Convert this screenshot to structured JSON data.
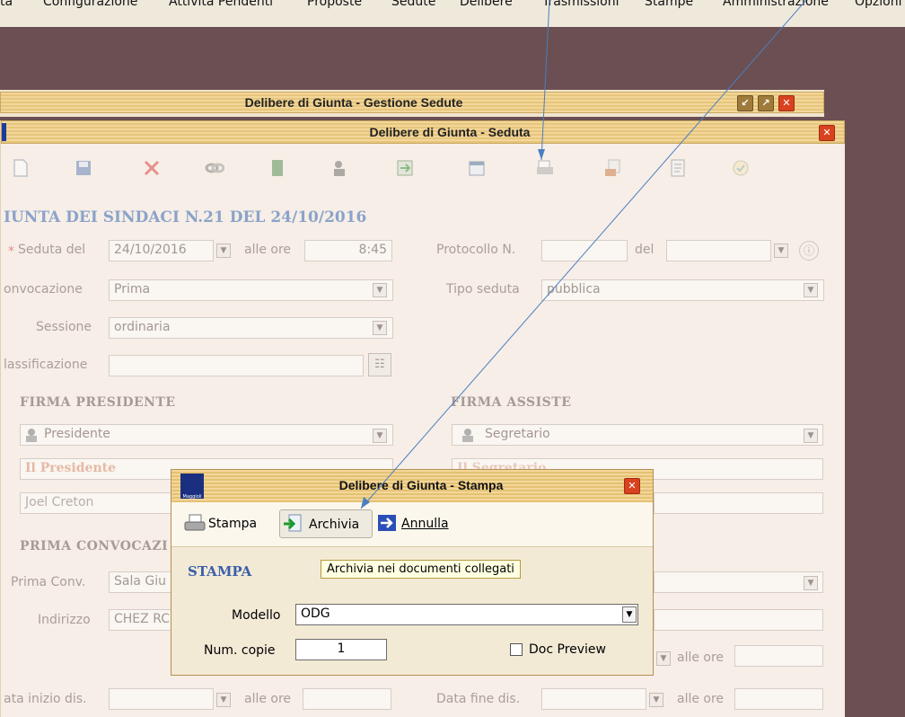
{
  "menu": [
    "ta",
    "Configurazione",
    "Attività Pendenti",
    "Proposte",
    "Sedute",
    "Delibere",
    "Trasmissioni",
    "Stampe",
    "Amministrazione",
    "Opzioni"
  ],
  "window_back": {
    "title": "Delibere di Giunta - Gestione Sedute"
  },
  "window_front": {
    "title": "Delibere di Giunta - Seduta"
  },
  "toolbar_icons": [
    "new-icon",
    "save-icon",
    "delete-icon",
    "link-icon",
    "book-icon",
    "users-icon",
    "import-icon",
    "calendar-icon",
    "print-icon",
    "archive-icon",
    "document-icon",
    "check-icon"
  ],
  "form": {
    "heading": "IUNTA DEI SINDACI N.21 DEL 24/10/2016",
    "seduta_del": {
      "label": "Seduta del",
      "required_mark": "*",
      "value": "24/10/2016"
    },
    "alle_ore": {
      "label": "alle ore",
      "value": "8:45"
    },
    "protocollo": {
      "label": "Protocollo N.",
      "value": ""
    },
    "del": {
      "label": "del",
      "value": ""
    },
    "convocazione": {
      "label": "onvocazione",
      "value": "Prima"
    },
    "tipo_seduta": {
      "label": "Tipo seduta",
      "value": "pubblica"
    },
    "sessione": {
      "label": "Sessione",
      "value": "ordinaria"
    },
    "classificazione": {
      "label": "lassificazione",
      "value": ""
    },
    "firma_presidente": {
      "section": "FIRMA PRESIDENTE",
      "role": "Presidente",
      "title": "Il Presidente",
      "name": "Joel Creton"
    },
    "firma_assiste": {
      "section": "FIRMA ASSISTE",
      "role": "Segretario",
      "title": "Il Segretario"
    },
    "prima_convocazione": {
      "section": "PRIMA CONVOCAZI",
      "prima_conv_label": "Prima Conv.",
      "prima_conv_value": "Sala Giu",
      "indirizzo_label": "Indirizzo",
      "indirizzo_value": "CHEZ RC"
    },
    "alle_ore_2": {
      "label": "alle ore"
    },
    "data_inizio": {
      "label": "ata inizio dis.",
      "alle_ore": "alle ore"
    },
    "data_fine": {
      "label": "Data fine dis.",
      "alle_ore": "alle ore"
    }
  },
  "dialog": {
    "logo_text": "Maggioli",
    "title": "Delibere di Giunta - Stampa",
    "buttons": {
      "stampa": "Stampa",
      "archivia": "Archivia",
      "annulla": "Annulla"
    },
    "section": "STAMPA",
    "tooltip": "Archivia nei documenti collegati",
    "modello": {
      "label": "Modello",
      "value": "ODG"
    },
    "num_copie": {
      "label": "Num. copie",
      "value": "1"
    },
    "doc_preview": {
      "label": "Doc Preview",
      "checked": false
    }
  }
}
